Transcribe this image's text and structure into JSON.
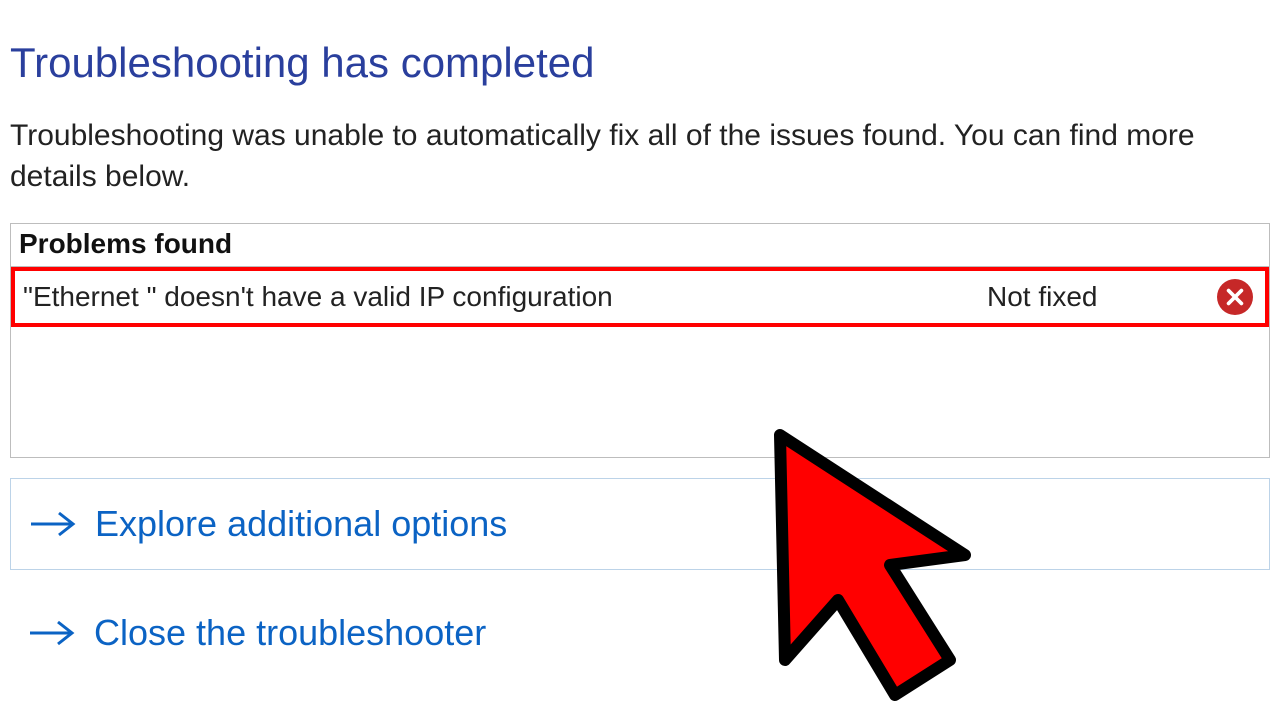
{
  "header": {
    "title": "Troubleshooting has completed",
    "description": "Troubleshooting was unable to automatically fix all of the issues found. You can find more details below."
  },
  "problems": {
    "heading": "Problems found",
    "items": [
      {
        "name": "\"Ethernet \" doesn't have a valid IP configuration",
        "status": "Not fixed",
        "status_icon": "error-x-icon"
      }
    ]
  },
  "options": [
    {
      "label": "Explore additional options",
      "icon": "arrow-right-icon"
    },
    {
      "label": "Close the troubleshooter",
      "icon": "arrow-right-icon"
    }
  ],
  "colors": {
    "title": "#2a3f9d",
    "link": "#0b63c4",
    "error": "#c62828",
    "highlight_border": "#ff0000"
  }
}
